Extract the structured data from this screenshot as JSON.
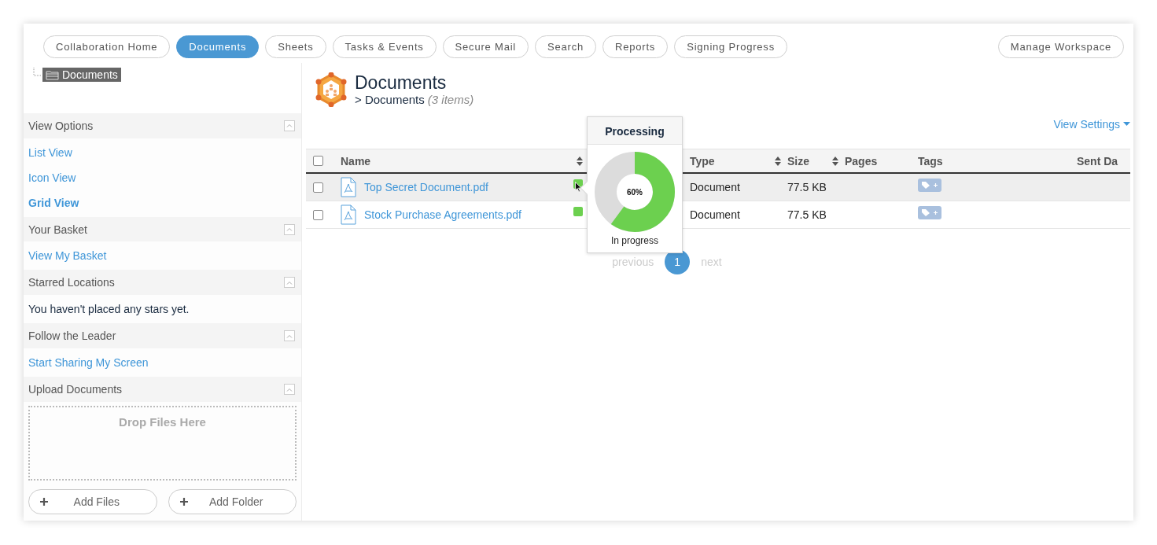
{
  "nav": {
    "tabs": [
      {
        "label": "Collaboration Home",
        "selected": false
      },
      {
        "label": "Documents",
        "selected": true
      },
      {
        "label": "Sheets",
        "selected": false
      },
      {
        "label": "Tasks & Events",
        "selected": false
      },
      {
        "label": "Secure Mail",
        "selected": false
      },
      {
        "label": "Search",
        "selected": false
      },
      {
        "label": "Reports",
        "selected": false
      },
      {
        "label": "Signing Progress",
        "selected": false
      }
    ],
    "manage": "Manage Workspace"
  },
  "tree": [
    {
      "label": "Documents",
      "selected": true
    }
  ],
  "sidebar": [
    {
      "title": "View Options",
      "expanded": true,
      "items": [
        {
          "kind": "link",
          "label": "List View",
          "selected": false
        },
        {
          "kind": "link",
          "label": "Icon View",
          "selected": false
        },
        {
          "kind": "link",
          "label": "Grid View",
          "selected": true
        }
      ]
    },
    {
      "title": "Your Basket",
      "expanded": true,
      "items": [
        {
          "kind": "link",
          "label": "View My Basket",
          "selected": false
        }
      ]
    },
    {
      "title": "Starred Locations",
      "expanded": true,
      "items": [
        {
          "kind": "text",
          "label": "You haven't placed any stars yet."
        }
      ]
    },
    {
      "title": "Follow the Leader",
      "expanded": true,
      "items": [
        {
          "kind": "link",
          "label": "Start Sharing My Screen",
          "selected": false
        }
      ]
    },
    {
      "title": "Upload Documents",
      "expanded": true,
      "items": [
        {
          "kind": "dropzone",
          "label": "Drop Files Here"
        }
      ],
      "buttons": [
        "Add Files",
        "Add Folder"
      ]
    }
  ],
  "header": {
    "title": "Documents",
    "breadcrumb": "> Documents",
    "count": "(3 items)",
    "view_settings": "View Settings"
  },
  "table": {
    "select_all": {
      "checked": false
    },
    "columns": [
      {
        "label": "Name",
        "sortable": true
      },
      {
        "label": "Type",
        "sortable": true
      },
      {
        "label": "Size",
        "sortable": true
      },
      {
        "label": "Pages",
        "sortable": false
      },
      {
        "label": "Tags",
        "sortable": false
      },
      {
        "label": "Sent Da",
        "sortable": false
      }
    ],
    "rows": [
      {
        "checked": false,
        "selected": true,
        "name": "Top Secret Document.pdf",
        "type": "Document",
        "size": "77.5 KB"
      },
      {
        "checked": false,
        "selected": false,
        "name": "Stock Purchase Agreements.pdf",
        "type": "Document",
        "size": "77.5 KB"
      }
    ]
  },
  "popover": {
    "title": "Processing",
    "level": 0.6,
    "reading": "60%",
    "status": "In progress"
  },
  "pagination": {
    "previous": {
      "label": "previous",
      "disabled": true
    },
    "pages": [
      {
        "label": "1",
        "selected": true
      }
    ],
    "next": {
      "label": "next",
      "disabled": true
    }
  }
}
